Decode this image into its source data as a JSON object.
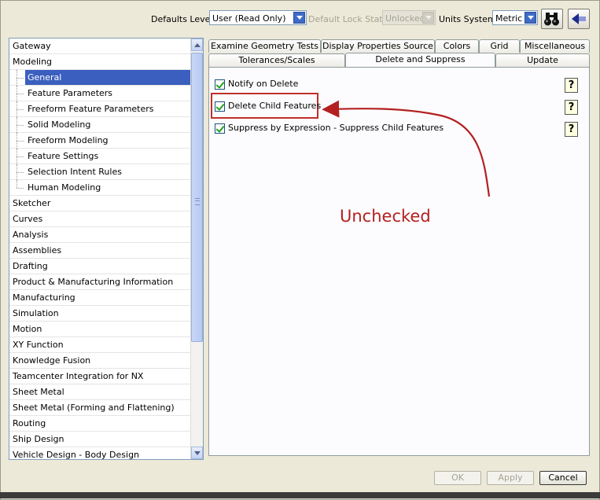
{
  "toolbar": {
    "defaults_level_label": "Defaults Level",
    "defaults_level_value": "User (Read Only)",
    "default_lock_state_label": "Default Lock State",
    "default_lock_state_value": "Unlocked",
    "units_system_label": "Units System",
    "units_system_value": "Metric",
    "find_button_icon": "binoculars-icon",
    "navigate_button_icon": "arrow-navigate-icon"
  },
  "tree": {
    "items": [
      {
        "label": "Gateway",
        "level": 0
      },
      {
        "label": "Modeling",
        "level": 0
      },
      {
        "label": "General",
        "level": 1,
        "selected": true
      },
      {
        "label": "Feature Parameters",
        "level": 1
      },
      {
        "label": "Freeform Feature Parameters",
        "level": 1
      },
      {
        "label": "Solid Modeling",
        "level": 1
      },
      {
        "label": "Freeform Modeling",
        "level": 1
      },
      {
        "label": "Feature Settings",
        "level": 1
      },
      {
        "label": "Selection Intent Rules",
        "level": 1
      },
      {
        "label": "Human Modeling",
        "level": 1
      },
      {
        "label": "Sketcher",
        "level": 0
      },
      {
        "label": "Curves",
        "level": 0
      },
      {
        "label": "Analysis",
        "level": 0
      },
      {
        "label": "Assemblies",
        "level": 0
      },
      {
        "label": "Drafting",
        "level": 0
      },
      {
        "label": "Product & Manufacturing Information",
        "level": 0
      },
      {
        "label": "Manufacturing",
        "level": 0
      },
      {
        "label": "Simulation",
        "level": 0
      },
      {
        "label": "Motion",
        "level": 0
      },
      {
        "label": "XY Function",
        "level": 0
      },
      {
        "label": "Knowledge Fusion",
        "level": 0
      },
      {
        "label": "Teamcenter Integration for NX",
        "level": 0
      },
      {
        "label": "Sheet Metal",
        "level": 0
      },
      {
        "label": "Sheet Metal (Forming and Flattening)",
        "level": 0
      },
      {
        "label": "Routing",
        "level": 0
      },
      {
        "label": "Ship Design",
        "level": 0
      },
      {
        "label": "Vehicle Design - Body Design",
        "level": 0
      }
    ]
  },
  "tabs": {
    "row1": [
      "Examine Geometry Tests",
      "Display Properties Source",
      "Colors",
      "Grid",
      "Miscellaneous"
    ],
    "row2": [
      "Tolerances/Scales",
      "Delete and Suppress",
      "Update"
    ],
    "active": "Delete and Suppress"
  },
  "options": [
    {
      "label": "Notify on Delete",
      "checked": true
    },
    {
      "label": "Delete Child Features",
      "checked": true
    },
    {
      "label": "Suppress by Expression - Suppress Child Features",
      "checked": true
    }
  ],
  "help_label": "?",
  "annotation": {
    "text": "Unchecked",
    "color": "#b42020"
  },
  "buttons": {
    "ok": "OK",
    "apply": "Apply",
    "cancel": "Cancel"
  }
}
